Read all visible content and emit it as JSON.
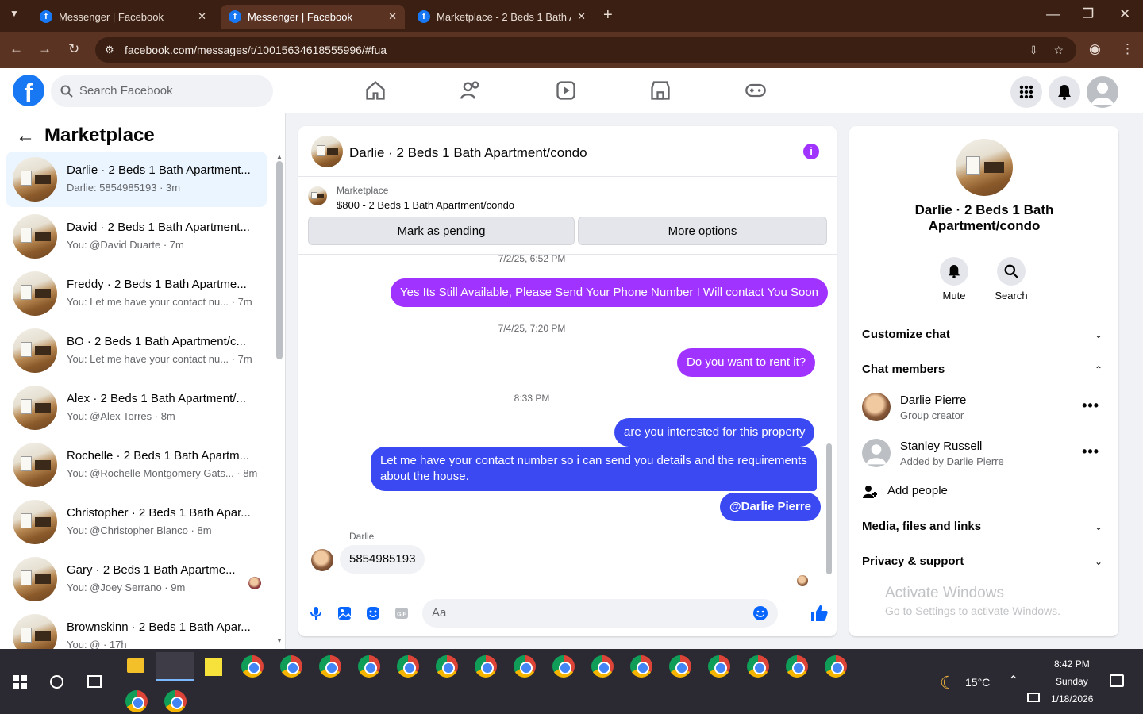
{
  "browser": {
    "tabs": [
      {
        "title": "Messenger | Facebook",
        "active": false
      },
      {
        "title": "Messenger | Facebook",
        "active": true
      },
      {
        "title": "Marketplace - 2 Beds 1 Bath Ap",
        "active": false
      }
    ],
    "url": "facebook.com/messages/t/10015634618555996/#fua"
  },
  "fb": {
    "search_placeholder": "Search Facebook"
  },
  "left": {
    "title": "Marketplace",
    "conversations": [
      {
        "name": "Darlie · 2 Beds 1 Bath Apartment...",
        "preview": "Darlie: 5854985193 · 3m",
        "selected": true
      },
      {
        "name": "David · 2 Beds 1 Bath Apartment...",
        "preview": "You: @David Duarte · 7m"
      },
      {
        "name": "Freddy · 2 Beds 1 Bath Apartme...",
        "preview": "You: Let me have your contact nu...  · 7m"
      },
      {
        "name": "BO · 2 Beds 1 Bath Apartment/c...",
        "preview": "You: Let me have your contact nu...  · 7m"
      },
      {
        "name": "Alex · 2 Beds 1 Bath Apartment/...",
        "preview": "You: @Alex Torres · 8m"
      },
      {
        "name": "Rochelle · 2 Beds 1 Bath Apartm...",
        "preview": "You: @Rochelle Montgomery Gats... · 8m"
      },
      {
        "name": "Christopher · 2 Beds 1 Bath Apar...",
        "preview": "You: @Christopher Blanco · 8m"
      },
      {
        "name": "Gary · 2 Beds 1 Bath Apartme...",
        "preview": "You: @Joey Serrano · 9m"
      },
      {
        "name": "Brownskinn · 2 Beds 1 Bath Apar...",
        "preview": "You: @ · 17h"
      }
    ]
  },
  "chat": {
    "title": "Darlie · 2 Beds 1 Bath Apartment/condo",
    "listing_source": "Marketplace",
    "listing_title": "$800 - 2 Beds 1 Bath Apartment/condo",
    "mark_pending_label": "Mark as pending",
    "more_options_label": "More options",
    "messages": {
      "ts1": "7/2/25, 6:52 PM",
      "m1": "Yes Its Still Available, Please Send Your Phone Number I Will contact You Soon",
      "ts2": "7/4/25, 7:20 PM",
      "m2": "Do you want to rent it?",
      "ts3": "8:33 PM",
      "m3": "are you interested for this property",
      "m4": "Let me have your contact number so i can send you details and the requirements about the house.",
      "m5": "@Darlie Pierre",
      "sender": "Darlie",
      "m6": "5854985193"
    },
    "composer_placeholder": "Aa"
  },
  "right": {
    "title": "Darlie · 2 Beds 1 Bath Apartment/condo",
    "mute_label": "Mute",
    "search_label": "Search",
    "customize_label": "Customize chat",
    "members_label": "Chat members",
    "members": [
      {
        "name": "Darlie Pierre",
        "role": "Group creator"
      },
      {
        "name": "Stanley Russell",
        "role": "Added by Darlie Pierre"
      }
    ],
    "add_people_label": "Add people",
    "media_label": "Media, files and links",
    "privacy_label": "Privacy & support"
  },
  "watermark": {
    "line1": "Activate Windows",
    "line2": "Go to Settings to activate Windows."
  },
  "taskbar": {
    "temperature": "15°C",
    "time": "8:42 PM",
    "day": "Sunday",
    "date": "1/18/2026"
  },
  "colors": {
    "fb_blue": "#1877f2",
    "purple_bubble": "#a033ff",
    "blue_bubble": "#3b49f2"
  }
}
